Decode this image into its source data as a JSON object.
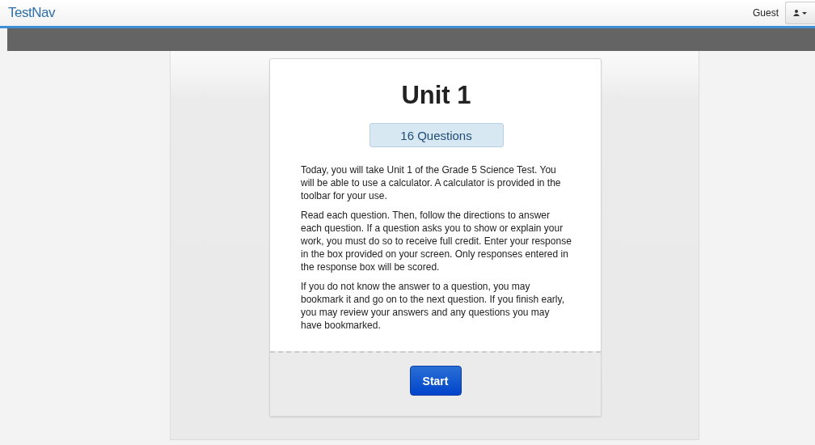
{
  "header": {
    "logo": "TestNav",
    "user": "Guest"
  },
  "card": {
    "title": "Unit 1",
    "badge": "16 Questions",
    "paragraphs": [
      "Today, you will take Unit 1 of the Grade 5 Science Test. You will be able to use a calculator. A calculator is provided in the toolbar for your use.",
      "Read each question. Then, follow the directions to answer each question. If a question asks you to show or explain your work, you must do so to receive full credit. Enter your response in the box provided on your screen. Only responses entered in the response box will be scored.",
      "If you do not know the answer to a question, you may bookmark it and go on to the next question. If you finish early, you may review your answers and any questions you may have bookmarked."
    ],
    "button": "Start"
  }
}
